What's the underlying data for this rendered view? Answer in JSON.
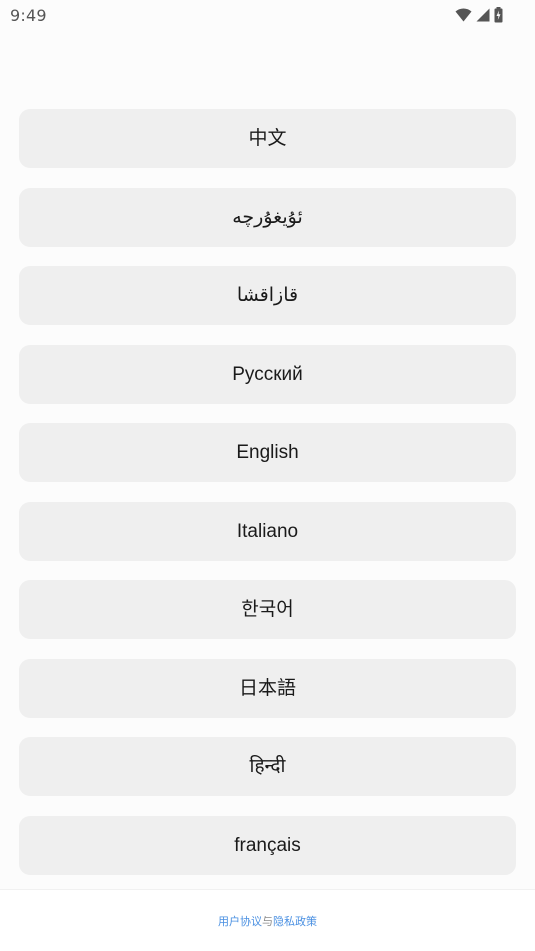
{
  "status_bar": {
    "time": "9:49",
    "icons": [
      "wifi-icon",
      "cellular-signal-icon",
      "battery-charging-icon"
    ]
  },
  "languages": [
    {
      "label": "中文"
    },
    {
      "label": "ئۇيغۇرچە"
    },
    {
      "label": "قازاقشا"
    },
    {
      "label": "Русский"
    },
    {
      "label": "English"
    },
    {
      "label": "Italiano"
    },
    {
      "label": "한국어"
    },
    {
      "label": "日本語"
    },
    {
      "label": "हिन्दी"
    },
    {
      "label": "français"
    }
  ],
  "footer": {
    "user_agreement": "用户协议",
    "and": "与",
    "privacy_policy": "隐私政策"
  },
  "colors": {
    "background": "#fcfcfc",
    "button_bg": "#efefef",
    "link": "#4a90e2"
  }
}
